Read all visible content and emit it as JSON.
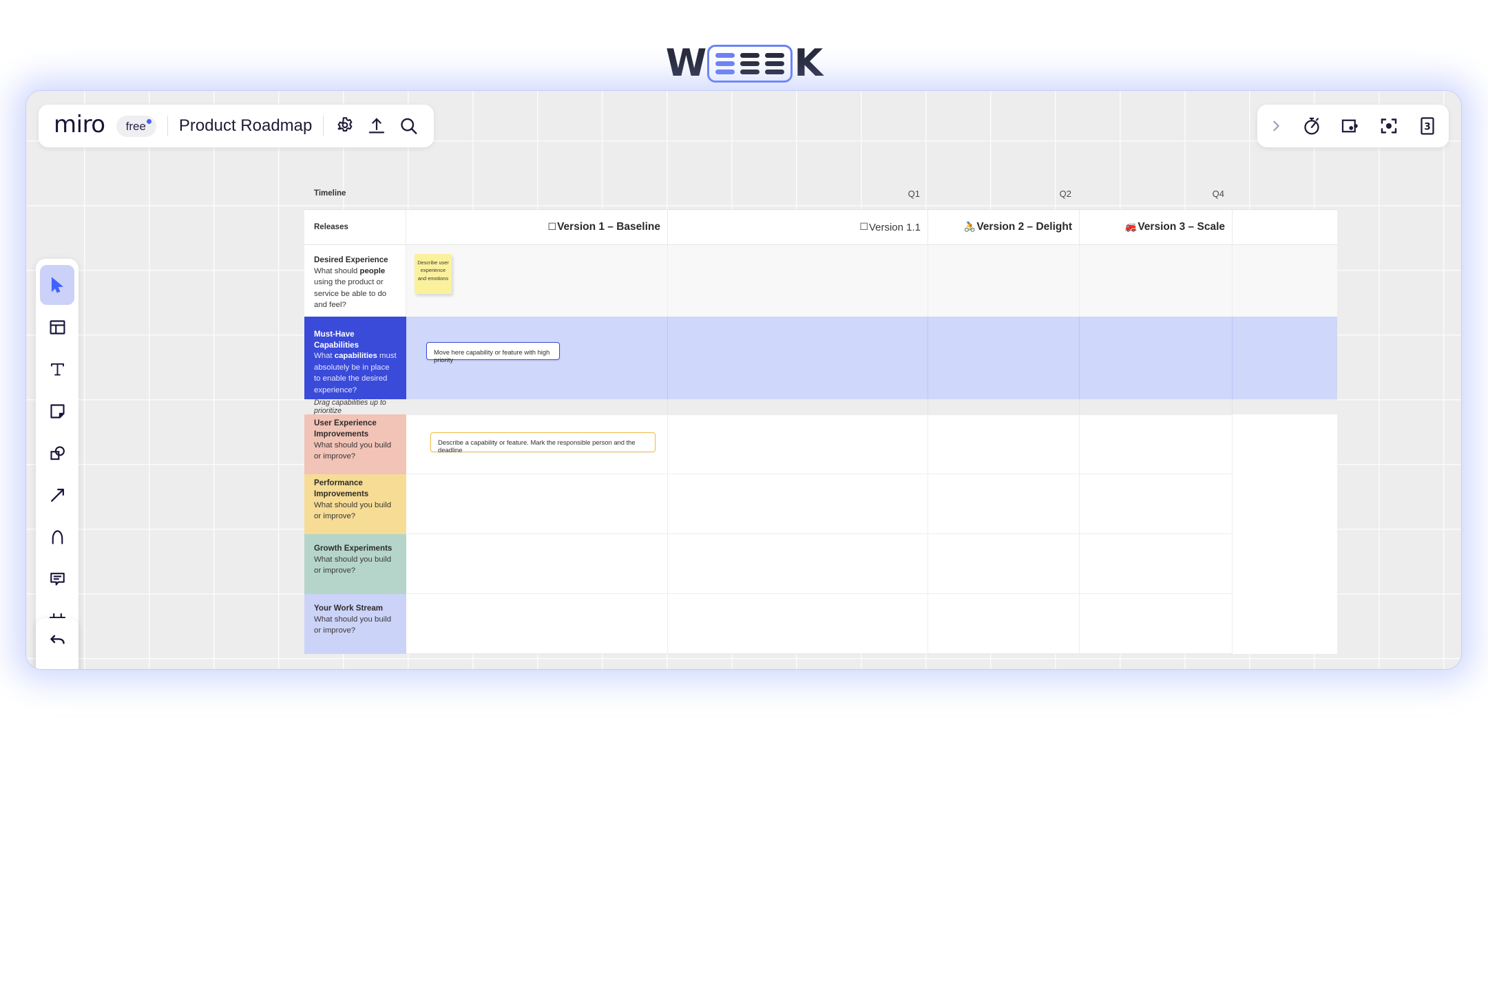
{
  "brand": {
    "letters_before": "W",
    "letters_after": "K",
    "name": "WEEEK"
  },
  "topbar": {
    "logo": "miro",
    "plan_badge": "free",
    "board_title": "Product Roadmap",
    "icons": [
      "gear-icon",
      "upload-icon",
      "search-icon"
    ]
  },
  "toolbar_right": {
    "icons": [
      "chevron-right-icon",
      "timer-icon",
      "present-icon",
      "frame-focus-icon",
      "card-count-icon"
    ],
    "card_count": "3"
  },
  "tools": {
    "items": [
      {
        "name": "select-cursor",
        "active": true
      },
      {
        "name": "templates",
        "active": false
      },
      {
        "name": "text",
        "active": false
      },
      {
        "name": "sticky-note",
        "active": false
      },
      {
        "name": "shapes",
        "active": false
      },
      {
        "name": "connector-arrow",
        "active": false
      },
      {
        "name": "pen",
        "active": false
      },
      {
        "name": "comment",
        "active": false
      },
      {
        "name": "frame",
        "active": false
      },
      {
        "name": "upload",
        "active": false
      },
      {
        "name": "more-apps",
        "active": false
      }
    ],
    "undo": "undo",
    "redo": "redo"
  },
  "board": {
    "timeline_label": "Timeline",
    "releases_label": "Releases",
    "quarters": [
      "",
      "Q1",
      "Q2",
      "Q4"
    ],
    "releases": [
      {
        "emoji": "☐",
        "label": "Version 1 – Baseline",
        "bold": true
      },
      {
        "emoji": "☐",
        "label": "Version 1.1",
        "bold": false
      },
      {
        "emoji": "🚴",
        "label": "Version 2 – Delight",
        "bold": true
      },
      {
        "emoji": "🚒",
        "label": "Version 3 – Scale",
        "bold": true
      }
    ],
    "rows": [
      {
        "title": "Desired Experience",
        "sub_pre": "What should ",
        "sub_bold": "people",
        "sub_post": " using the product or service be able to do and feel?",
        "sticky": "Describe user experience and emotions"
      },
      {
        "title": "Must-Have Capabilities",
        "sub_pre": "What ",
        "sub_bold": "capabilities",
        "sub_post": " must absolutely be in place to enable the desired experience?",
        "card": "Move here capability or feature with high priority"
      },
      {
        "title": "User Experience Improvements",
        "sub": "What should you build or improve?",
        "card": "Describe a capability or feature. Mark the responsible person and the deadline"
      },
      {
        "title": "Performance Improvements",
        "sub": "What should you build or improve?"
      },
      {
        "title": "Growth Experiments",
        "sub": "What should you build or improve?"
      },
      {
        "title": "Your Work Stream",
        "sub": "What should you build or improve?"
      }
    ],
    "drag_hint": "Drag capabilities up to prioritize"
  },
  "colors": {
    "brand_blue": "#6b82f6",
    "miro_accent": "#4262ff",
    "must_have_label": "#3a4ad9",
    "must_have_row": "#cfd7fa",
    "ux_row": "#f2c3b7",
    "perf_row": "#f6dc95",
    "growth_row": "#b5d5cb",
    "work_row": "#ccd3f8",
    "sticky_yellow": "#fbf19c",
    "card_amber_border": "#f2bc3f"
  }
}
